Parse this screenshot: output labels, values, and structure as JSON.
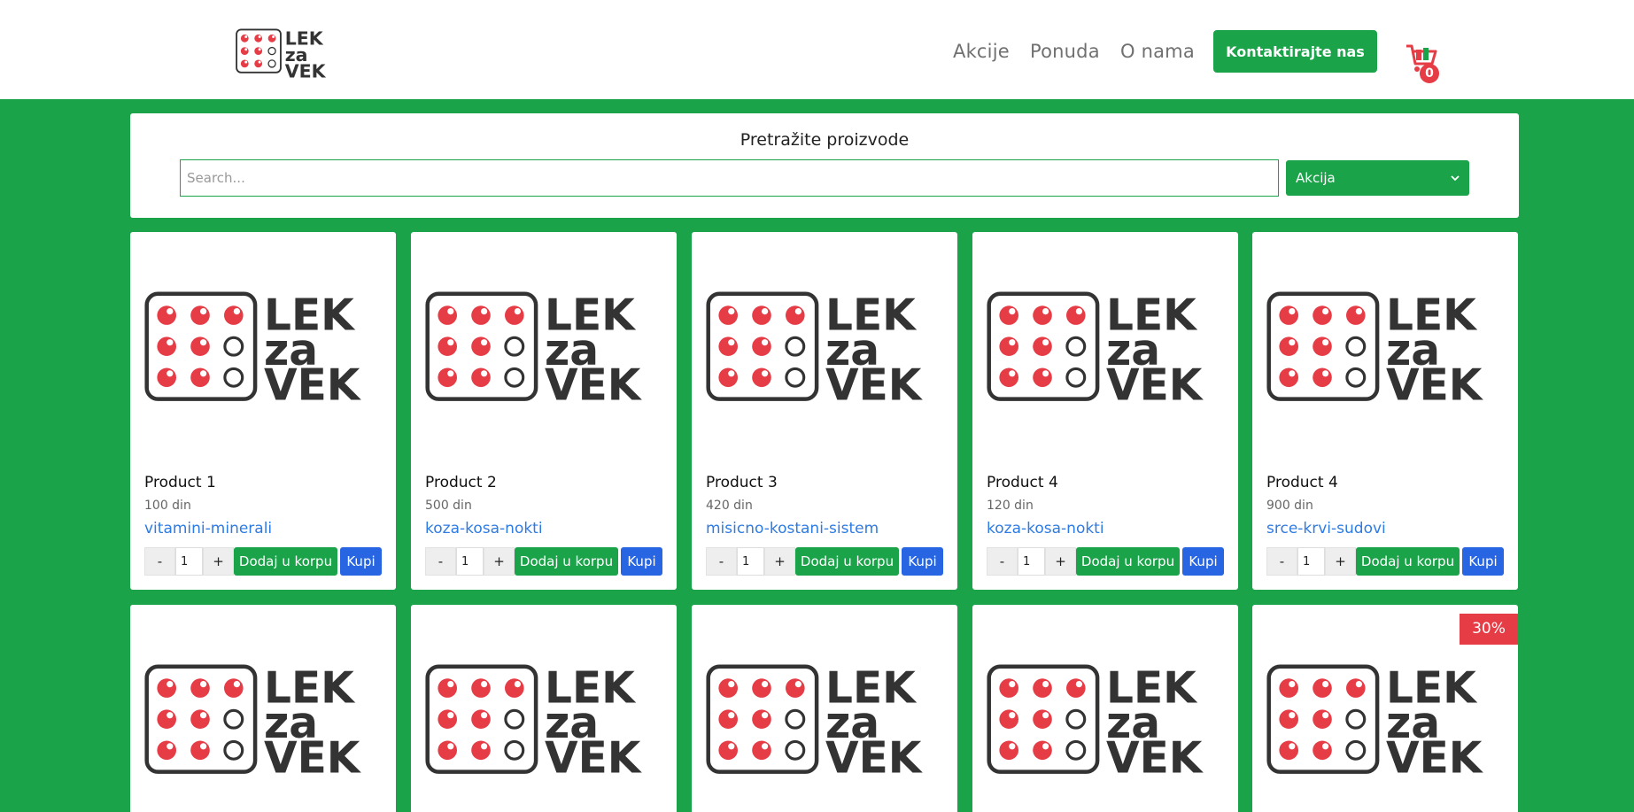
{
  "brand": {
    "line1": "LEK",
    "line2": "za",
    "line3": "VEK"
  },
  "nav": {
    "items": [
      {
        "label": "Akcije"
      },
      {
        "label": "Ponuda"
      },
      {
        "label": "O nama"
      }
    ],
    "contact_label": "Kontaktirajte nas",
    "cart_count": "0"
  },
  "search": {
    "title": "Pretražite proizvode",
    "placeholder": "Search...",
    "filter_selected": "Akcija"
  },
  "product_labels": {
    "add_to_cart": "Dodaj u korpu",
    "buy": "Kupi",
    "minus": "-",
    "plus": "+"
  },
  "products": [
    {
      "name": "Product 1",
      "price": "100 din",
      "category": "vitamini-minerali",
      "qty": "1"
    },
    {
      "name": "Product 2",
      "price": "500 din",
      "category": "koza-kosa-nokti",
      "qty": "1"
    },
    {
      "name": "Product 3",
      "price": "420 din",
      "category": "misicno-kostani-sistem",
      "qty": "1"
    },
    {
      "name": "Product 4",
      "price": "120 din",
      "category": "koza-kosa-nokti",
      "qty": "1"
    },
    {
      "name": "Product 4",
      "price": "900 din",
      "category": "srce-krvi-sudovi",
      "qty": "1"
    }
  ],
  "second_row": {
    "discount_badge": "30%"
  },
  "colors": {
    "accent": "#1ba34a",
    "brand_red": "#e63c46",
    "link_blue": "#2e7be3",
    "buy_blue": "#2765e3",
    "logo_dark": "#333333"
  }
}
